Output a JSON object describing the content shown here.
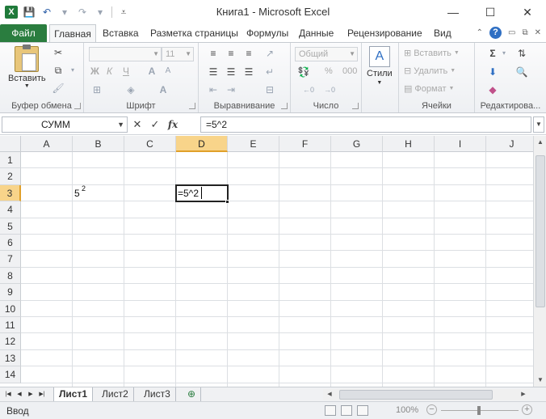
{
  "window": {
    "title": "Книга1 - Microsoft Excel",
    "app_logo": "X",
    "minimize": "—",
    "maximize": "☐",
    "close": "✕"
  },
  "ribbon_tabs": {
    "file": "Файл",
    "home": "Главная",
    "insert": "Вставка",
    "page_layout": "Разметка страницы",
    "formulas": "Формулы",
    "data": "Данные",
    "review": "Рецензирование",
    "view": "Вид"
  },
  "ribbon": {
    "clipboard": {
      "label": "Буфер обмена",
      "paste": "Вставить"
    },
    "font": {
      "label": "Шрифт",
      "font_name": "",
      "font_size": "11",
      "bold": "Ж",
      "italic": "К",
      "underline": "Ч"
    },
    "alignment": {
      "label": "Выравнивание"
    },
    "number": {
      "label": "Число",
      "format": "Общий",
      "percent": "%",
      "thousands": "000"
    },
    "styles": {
      "label": "Стили"
    },
    "cells": {
      "label": "Ячейки",
      "insert": "Вставить",
      "delete": "Удалить",
      "format": "Формат"
    },
    "editing": {
      "label": "Редактирова..."
    }
  },
  "formula_bar": {
    "name_box": "СУММ",
    "fx": "fx",
    "formula": "=5^2"
  },
  "grid": {
    "columns": [
      "A",
      "B",
      "C",
      "D",
      "E",
      "F",
      "G",
      "H",
      "I",
      "J"
    ],
    "selected_column": "D",
    "rows": [
      "1",
      "2",
      "3",
      "4",
      "5",
      "6",
      "7",
      "8",
      "9",
      "10",
      "11",
      "12",
      "13",
      "14"
    ],
    "selected_row": "3",
    "cells": {
      "B3_base": "5",
      "B3_superscript": "2",
      "D3": "=5^2"
    }
  },
  "sheets": [
    "Лист1",
    "Лист2",
    "Лист3"
  ],
  "active_sheet": "Лист1",
  "status": {
    "mode": "Ввод",
    "zoom": "100%"
  },
  "colors": {
    "file_tab": "#2a7d3f",
    "selected_header": "#f8d48a",
    "accent_border": "#e0a02a"
  }
}
